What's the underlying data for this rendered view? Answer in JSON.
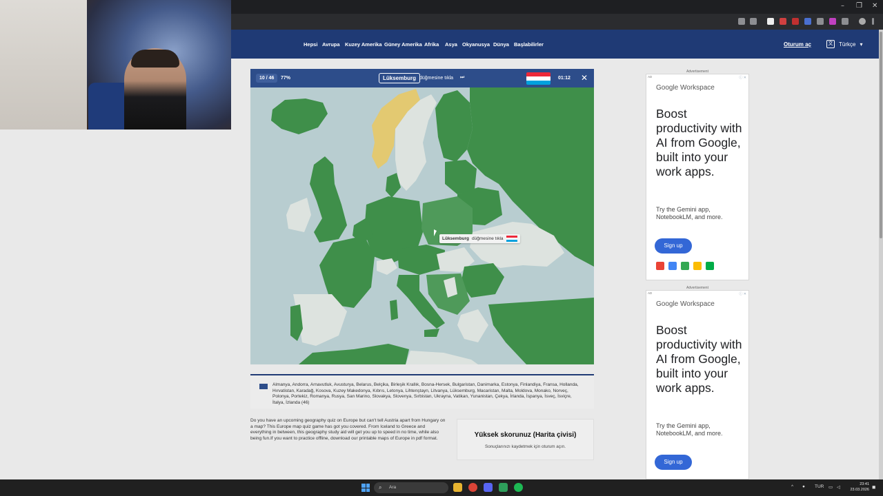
{
  "nav": {
    "items": [
      "Hepsi",
      "Avrupa",
      "Kuzey Amerika",
      "Güney Amerika",
      "Afrika",
      "Asya",
      "Okyanusya",
      "Dünya",
      "Başlabilirler"
    ],
    "login": "Oturum aç",
    "language": "Türkçe"
  },
  "quiz": {
    "progress": "10 / 46",
    "percent": "77%",
    "target": "Lüksemburg",
    "action": "düğmesine tıkla",
    "skip_icon": "skip-icon",
    "timer": "01:12",
    "flag_colors": [
      "#ed2939",
      "#ffffff",
      "#00a1de"
    ],
    "tooltip_target": "Lüksemburg",
    "tooltip_action": "düğmesine tıkla"
  },
  "countries_text": "Almanya, Andorra, Arnavutluk, Avusturya, Belarus, Belçika, Birleşik Krallık, Bosna-Hersek, Bulgaristan, Danimarka, Estonya, Finlandiya, Fransa, Hollanda, Hırvatistan, Karadağ, Kosova, Kuzey Makedonya, Kıbrıs, Letonya, Lihtenştayn, Litvanya, Lüksemburg, Macaristan, Malta, Moldova, Monako, Norveç, Polonya, Portekiz, Romanya, Rusya, San Marino, Slovakya, Slovenya, Sırbistan, Ukrayna, Vatikan, Yunanistan, Çekya, İrlanda, İspanya, İsveç, İsviçre, İtalya, İzlanda (46)",
  "description": "Do you have an upcoming geography quiz on Europe but can't tell Austria apart from Hungary on a map? This Europe map quiz game has got you covered. From Iceland to Greece and everything in between, this geography study aid will get you up to speed in no time, while also being fun.If you want to practice offline, download our printable maps of Europe in pdf format.",
  "score": {
    "title": "Yüksek skorunuz (Harita çivisi)",
    "subtitle": "Sonuçlarınızı kaydetmek için oturum açın."
  },
  "ads": [
    {
      "label": "Advertisement",
      "ad_badge": "AD",
      "brand": "Google",
      "brand_suffix": "Workspace",
      "headline": "Boost productivity with AI from Google, built into your work apps.",
      "subtext": "Try the Gemini app, NotebookLM, and more.",
      "cta": "Sign up"
    },
    {
      "label": "Advertisement",
      "ad_badge": "AD",
      "brand": "Google",
      "brand_suffix": "Workspace",
      "headline": "Boost productivity with AI from Google, built into your work apps.",
      "subtext": "Try the Gemini app, NotebookLM, and more.",
      "cta": "Sign up"
    }
  ],
  "taskbar": {
    "search_placeholder": "Ara",
    "lang": "TUR",
    "time": "23:41",
    "date": "23.03.2026"
  },
  "colors": {
    "nav_bg": "#1f3a75",
    "found_green": "#3f8f4a",
    "active_green": "#4f9a5a",
    "yellow": "#e3c971",
    "unfound": "#dde3df",
    "sea": "#b8cdd0"
  }
}
